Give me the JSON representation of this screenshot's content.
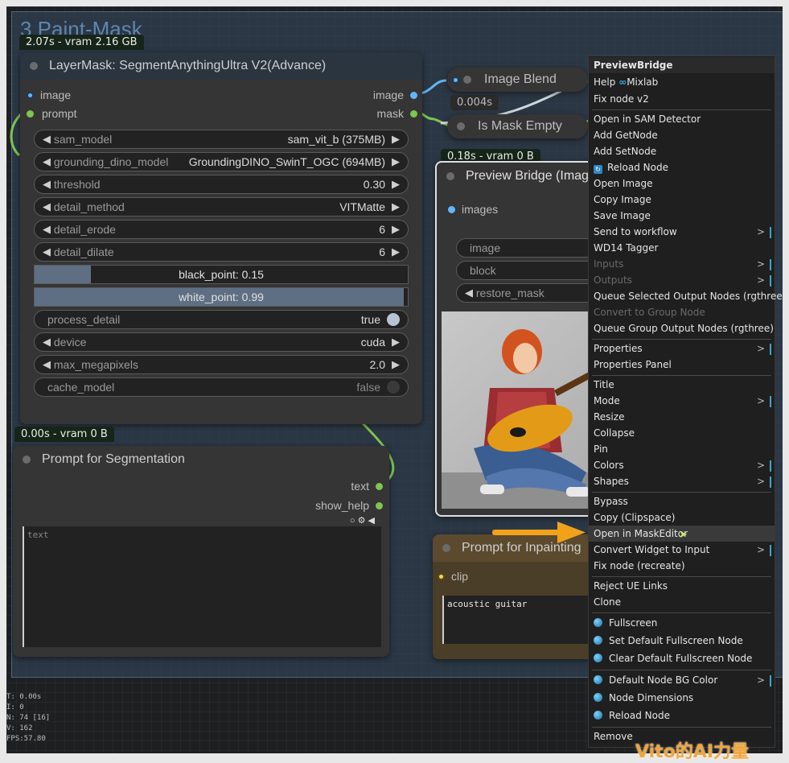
{
  "group": {
    "title": "3  Paint-Mask"
  },
  "badges": {
    "segment": "2.07s - vram 2.16 GB",
    "preview": "0.18s - vram 0 B",
    "prompt": "0.00s - vram 0 B",
    "blend": "0.004s"
  },
  "segment_node": {
    "title": "LayerMask: SegmentAnythingUltra V2(Advance)",
    "inputs": [
      "image",
      "prompt"
    ],
    "outputs": [
      "image",
      "mask"
    ],
    "widgets": [
      {
        "label": "sam_model",
        "value": "sam_vit_b (375MB)"
      },
      {
        "label": "grounding_dino_model",
        "value": "GroundingDINO_SwinT_OGC (694MB)"
      },
      {
        "label": "threshold",
        "value": "0.30"
      },
      {
        "label": "detail_method",
        "value": "VITMatte"
      },
      {
        "label": "detail_erode",
        "value": "6"
      },
      {
        "label": "detail_dilate",
        "value": "6"
      }
    ],
    "black_point": "black_point: 0.15",
    "black_point_fraction": 0.15,
    "white_point": "white_point: 0.99",
    "white_point_fraction": 0.99,
    "process_detail": {
      "label": "process_detail",
      "value": "true"
    },
    "device": {
      "label": "device",
      "value": "cuda"
    },
    "max_megapixels": {
      "label": "max_megapixels",
      "value": "2.0"
    },
    "cache_model": {
      "label": "cache_model",
      "value": "false"
    }
  },
  "image_blend": {
    "title": "Image Blend"
  },
  "is_mask_empty": {
    "title": "Is Mask Empty"
  },
  "preview_node": {
    "title": "Preview Bridge (Image)",
    "input": "images",
    "widgets": [
      "image",
      "block",
      "restore_mask"
    ]
  },
  "prompt_seg": {
    "title": "Prompt for Segmentation",
    "outputs": [
      "text",
      "show_help"
    ],
    "placeholder": "text"
  },
  "prompt_inpaint": {
    "title": "Prompt for Inpainting",
    "input": "clip",
    "text": "acoustic guitar"
  },
  "stats": [
    "T: 0.00s",
    "I: 0",
    "N: 74 [16]",
    "V: 162",
    "FPS:57.80"
  ],
  "menu": {
    "title": "PreviewBridge",
    "help": "Help",
    "mixlab": "Mixlab",
    "items_a": [
      "Fix node v2"
    ],
    "items_b": [
      "Open in SAM Detector",
      "Add GetNode",
      "Add SetNode",
      "Reload Node",
      "Open Image",
      "Copy Image",
      "Save Image",
      "Send to workflow",
      "WD14 Tagger",
      "Inputs",
      "Outputs",
      "Queue Selected Output Nodes (rgthree)",
      "Convert to Group Node",
      "Queue Group Output Nodes (rgthree)"
    ],
    "items_c": [
      "Properties",
      "Properties Panel"
    ],
    "items_d": [
      "Title",
      "Mode",
      "Resize",
      "Collapse",
      "Pin",
      "Colors",
      "Shapes"
    ],
    "items_e": [
      "Bypass",
      "Copy (Clipspace)",
      "Open in MaskEditor",
      "Convert Widget to Input",
      "Fix node (recreate)"
    ],
    "items_f": [
      "Reject UE Links",
      "Clone"
    ],
    "items_g": [
      "Fullscreen",
      "Set Default Fullscreen Node",
      "Clear Default Fullscreen Node"
    ],
    "items_h": [
      "Default Node BG Color",
      "Node Dimensions",
      "Reload Node"
    ],
    "remove": "Remove"
  },
  "watermark": "Vito的AI力量",
  "colors": {
    "accent_arrow": "#f0a21a",
    "link_green": "#7ec650",
    "image_slot": "#64b5f6"
  }
}
